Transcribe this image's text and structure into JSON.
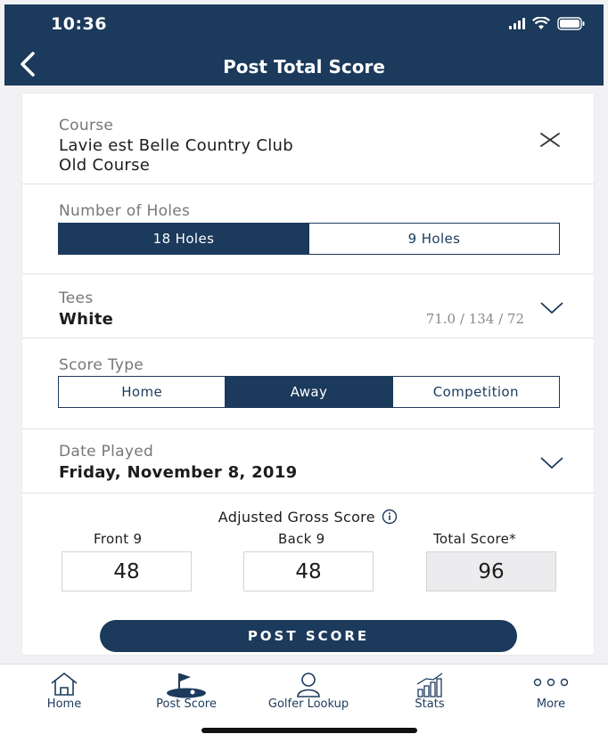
{
  "status_bar": {
    "time": "10:36"
  },
  "nav": {
    "title": "Post Total Score"
  },
  "course": {
    "label": "Course",
    "name": "Lavie est Belle Country Club",
    "sub": "Old Course"
  },
  "holes": {
    "label": "Number of Holes",
    "options": [
      "18 Holes",
      "9 Holes"
    ],
    "selected": "18 Holes"
  },
  "tees": {
    "label": "Tees",
    "value": "White",
    "rating": "71.0 / 134 / 72"
  },
  "score_type": {
    "label": "Score Type",
    "options": [
      "Home",
      "Away",
      "Competition"
    ],
    "selected": "Away"
  },
  "date": {
    "label": "Date Played",
    "value": "Friday, November 8, 2019"
  },
  "scores": {
    "heading": "Adjusted Gross Score",
    "front_label": "Front 9",
    "front_value": "48",
    "back_label": "Back 9",
    "back_value": "48",
    "total_label": "Total Score*",
    "total_value": "96"
  },
  "post_button": "POST SCORE",
  "tabbar": {
    "items": [
      "Home",
      "Post Score",
      "Golfer Lookup",
      "Stats",
      "More"
    ]
  },
  "colors": {
    "primary": "#1b3a5c",
    "total_bg": "#ececee"
  }
}
